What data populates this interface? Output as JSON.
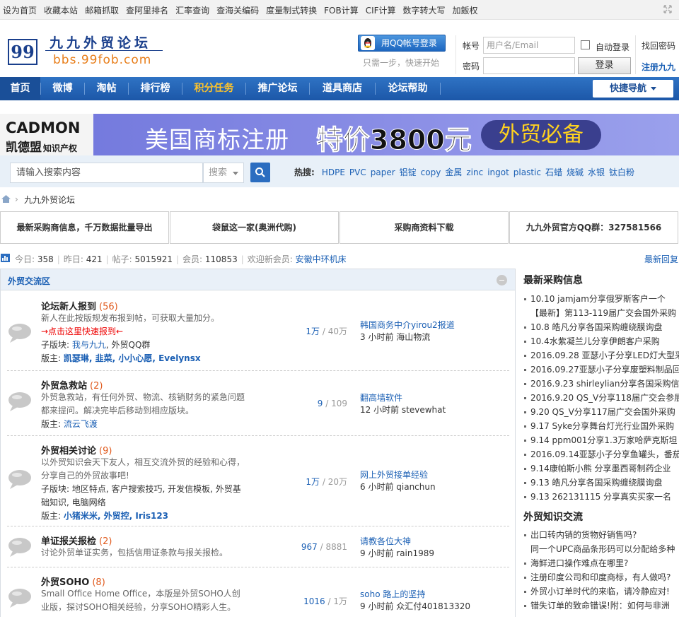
{
  "topbar": {
    "links": [
      "设为首页",
      "收藏本站",
      "邮箱抓取",
      "查阿里排名",
      "汇率查询",
      "查海关编码",
      "度量制式转换",
      "FOB计算",
      "CIF计算",
      "数字转大写",
      "加飯权"
    ]
  },
  "header": {
    "logo_mark": "99",
    "logo_cn": "九九外贸论坛",
    "logo_url": "bbs.99fob.com",
    "qq_login_label": "用QQ帐号登录",
    "qq_tip": "只需一步，快速开始",
    "account_label": "帐号",
    "password_label": "密码",
    "username_placeholder": "用户名/Email",
    "auto_login_label": "自动登录",
    "login_button": "登录",
    "forgot_password": "找回密码",
    "register": "注册九九"
  },
  "nav": {
    "items": [
      "首页",
      "微博",
      "淘帖",
      "排行榜",
      "积分任务",
      "推广论坛",
      "道具商店",
      "论坛帮助"
    ],
    "quick_nav": "快捷导航"
  },
  "banner": {
    "brand_en": "CADMON",
    "brand_cn": "凯德盟",
    "brand_sub": "知识产权",
    "headline": "美国商标注册",
    "price": "特价3800元",
    "tag": "外贸必备"
  },
  "search": {
    "placeholder": "请输入搜索内容",
    "type": "搜索",
    "hot_label": "热搜:",
    "hot_words": [
      "HDPE",
      "PVC",
      "paper",
      "铝锭",
      "copy",
      "金属",
      "zinc",
      "ingot",
      "plastic",
      "石蜡",
      "烧碱",
      "水银",
      "钛白粉"
    ]
  },
  "breadcrumb": {
    "current": "九九外贸论坛"
  },
  "features": [
    "最新采购商信息，千万数据批量导出",
    "袋鼠这一家(奥洲代购)",
    "采购商资料下载",
    "九九外贸官方QQ群：327581566"
  ],
  "stats": {
    "today_label": "今日:",
    "today": "358",
    "yesterday_label": "昨日:",
    "yesterday": "421",
    "posts_label": "帖子:",
    "posts": "5015921",
    "members_label": "会员:",
    "members": "110853",
    "welcome_label": "欢迎新会员:",
    "newest_member": "安徽中环机床",
    "latest_replies": "最新回复"
  },
  "category": {
    "title": "外贸交流区"
  },
  "forums": [
    {
      "name": "论坛新人报到",
      "count": "(56)",
      "desc": "新人在此按版规发布报到帖，可获取大量加分。",
      "notice": "→点击这里快速报到←",
      "sub_label": "子版块:",
      "sub_value": "我与九九",
      "sub_extra": ", 外贸QQ群",
      "moder_label": "版主:",
      "moders": "凯瑟琳, 韭菜, 小小心愿, Evelynsx",
      "threads": "1万",
      "posts": "40万",
      "last_title": "韩国商务中介yirou2报道",
      "last_meta": "3 小时前  海山物流"
    },
    {
      "name": "外贸急救站",
      "count": "(2)",
      "desc": "外贸急救站，有任何外贸、物流、核销财务的紧急问题都来提问。解决完毕后移动到相应版块。",
      "moder_label": "版主:",
      "moders": "流云飞渡",
      "threads": "9",
      "posts": "109",
      "last_title": "翻高墙软件",
      "last_meta": "12 小时前  stevewhat"
    },
    {
      "name": "外贸相关讨论",
      "count": "(9)",
      "desc": "以外贸知识会天下友人，相互交流外贸的经验和心得，分享自己的外贸故事吧!",
      "sub_label": "子版块:",
      "sub_value": "地区特点, 客户搜索技巧, 开发信模板, 外贸基础知识, 电脑网络",
      "moder_label": "版主:",
      "moders": "小猪米米, 外贸控, Iris123",
      "threads": "1万",
      "posts": "20万",
      "last_title": "网上外贸接单经验",
      "last_meta": "6 小时前  qianchun"
    },
    {
      "name": "单证报关报检",
      "count": "(2)",
      "desc": "讨论外贸单证实务，包括信用证条款与报关报检。",
      "threads": "967",
      "posts": "8881",
      "last_title": "请教各位大神",
      "last_meta": "9 小时前  rain1989"
    },
    {
      "name": "外贸SOHO",
      "count": "(8)",
      "desc": "Small Office Home Office，本版是外贸SOHO人创业版，探讨SOHO相关经验，分享SOHO精彩人生。",
      "threads": "1016",
      "posts": "1万",
      "last_title": "soho 路上的坚持",
      "last_meta": "9 小时前  众汇付401813320"
    }
  ],
  "sidebar": {
    "purchase_title": "最新采购信息",
    "purchase_items": [
      "10.10 jamjam分享俄罗斯客户一个",
      "【最新】第113-119届广交会国外采购",
      "10.8 皓凡分享各国采购缠绕膜询盘",
      "10.4水紫凝兰儿分享伊朗客户采购",
      "2016.09.28 亚瑟小子分享LED灯大型采",
      "2016.09.27亚瑟小子分享废塑料制品回",
      "2016.9.23 shirleylian分享各国采购信息",
      "2016.9.20 QS_V分享118届广交会参展",
      "9.20 QS_V分享117届广交会国外采购",
      "9.17 Syke分享舞台灯光行业国外采购",
      "9.14 ppm001分享1.3万家哈萨克斯坦",
      "2016.09.14亚瑟小子分享鱼罐头，番茄",
      "9.14康帕斯小熊 分享墨西哥制药企业",
      "9.13 皓凡分享各国采购缠绕膜询盘",
      "9.13 262131115 分享真实买家一名"
    ],
    "knowledge_title": "外贸知识交流",
    "knowledge_items": [
      "出口转内销的货物好销售吗?",
      "同一个UPC商品条形码可以分配给多种",
      "海鲜进口操作难点在哪里?",
      "注册印度公司和印度商标，有人做吗?",
      "外贸小订单时代的来临，请冷静应对!",
      "错失订单的致命错误!附：如何与非洲"
    ]
  }
}
